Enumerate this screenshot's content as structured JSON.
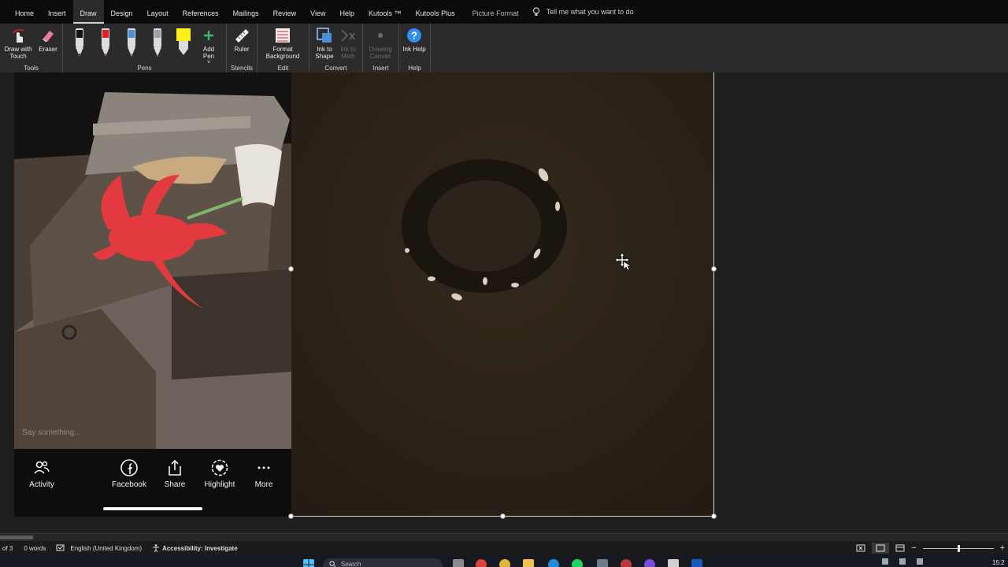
{
  "menu": {
    "tabs": [
      "Home",
      "Insert",
      "Draw",
      "Design",
      "Layout",
      "References",
      "Mailings",
      "Review",
      "View",
      "Help",
      "Kutools ™",
      "Kutools Plus",
      "Picture Format"
    ],
    "active_tab": "Draw",
    "tell_me": "Tell me what you want to do"
  },
  "ribbon": {
    "tools": {
      "draw_touch": "Draw with Touch",
      "eraser": "Eraser",
      "label": "Tools"
    },
    "pens": {
      "add_pen": "Add Pen",
      "label": "Pens",
      "colors": [
        "#111111",
        "#e02020",
        "#4a8fd8",
        "#9aa0a6",
        "#ffef1a"
      ]
    },
    "stencils": {
      "ruler": "Ruler",
      "label": "Stencils"
    },
    "edit": {
      "format_background": "Format Background",
      "label": "Edit"
    },
    "convert": {
      "ink_to_shape": "Ink to Shape",
      "ink_to_math": "Ink to Math",
      "label": "Convert"
    },
    "insert": {
      "drawing_canvas": "Drawing Canvas",
      "label": "Insert"
    },
    "help": {
      "ink_help": "Ink Help",
      "label": "Help"
    }
  },
  "left_image": {
    "comment_placeholder": "Say something...",
    "actions": [
      {
        "label": "Activity",
        "icon": "people-icon"
      },
      {
        "label": "Facebook",
        "icon": "facebook-icon"
      },
      {
        "label": "Share",
        "icon": "share-icon"
      },
      {
        "label": "Highlight",
        "icon": "highlight-icon"
      },
      {
        "label": "More",
        "icon": "more-icon"
      }
    ]
  },
  "status_bar": {
    "page": "of 3",
    "words": "0 words",
    "language": "English (United Kingdom)",
    "accessibility": "Accessibility: Investigate"
  },
  "taskbar": {
    "search_placeholder": "Search",
    "clock": "15:2"
  },
  "colors": {
    "accent": "#0a5fb4",
    "ribbon_bg": "#2b2b2b",
    "menubar_bg": "#0b0b0b"
  }
}
